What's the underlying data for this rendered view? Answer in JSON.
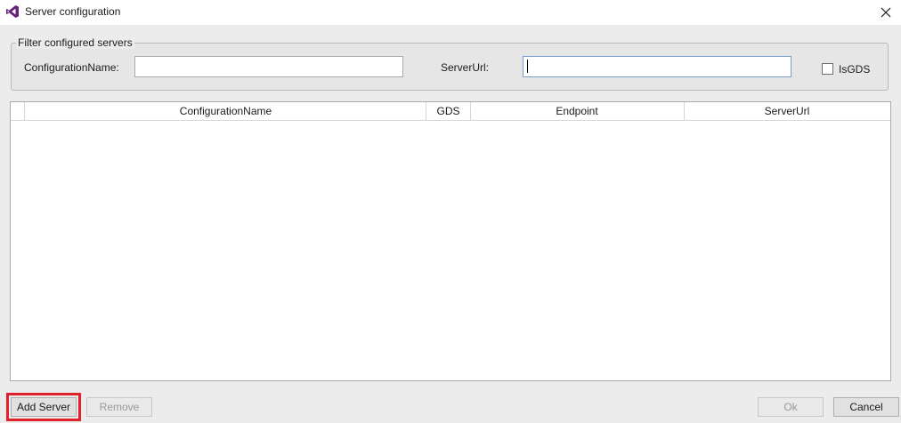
{
  "window": {
    "title": "Server configuration",
    "icon": "visual-studio-icon"
  },
  "filter": {
    "group_label": "Filter configured servers",
    "configuration_name_label": "ConfigurationName:",
    "configuration_name_value": "",
    "server_url_label": "ServerUrl:",
    "server_url_value": "",
    "is_gds_label": "IsGDS",
    "is_gds_checked": false
  },
  "grid": {
    "columns": [
      "ConfigurationName",
      "GDS",
      "Endpoint",
      "ServerUrl"
    ],
    "rows": []
  },
  "footer": {
    "add_server_label": "Add Server",
    "remove_label": "Remove",
    "ok_label": "Ok",
    "cancel_label": "Cancel"
  },
  "colors": {
    "accent": "#68217a",
    "highlight": "#e0202a"
  }
}
